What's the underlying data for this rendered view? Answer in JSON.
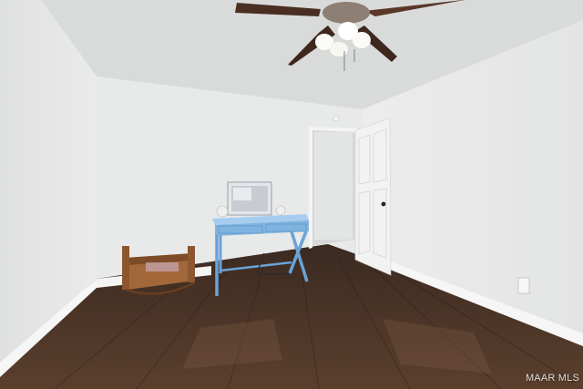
{
  "scene": {
    "description_tag": "empty-bedroom-photo",
    "watermark": "MAAR MLS"
  },
  "colors": {
    "wall": "#e7e8e8",
    "ceiling": "#dcdddd",
    "floor_dark": "#3a2a20",
    "floor_mid": "#5a4130",
    "desk": "#7fb3e0",
    "door": "#f3f3f3",
    "fan_blade": "#4a2e22"
  }
}
